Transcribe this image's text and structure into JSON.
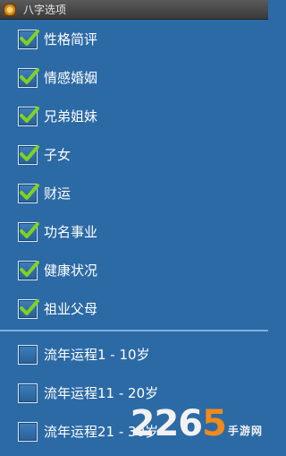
{
  "window": {
    "title": "八字选项"
  },
  "options": [
    {
      "label": "性格简评",
      "checked": true
    },
    {
      "label": "情感婚姻",
      "checked": true
    },
    {
      "label": "兄弟姐妹",
      "checked": true
    },
    {
      "label": "子女",
      "checked": true
    },
    {
      "label": "财运",
      "checked": true
    },
    {
      "label": "功名事业",
      "checked": true
    },
    {
      "label": "健康状况",
      "checked": true
    },
    {
      "label": "祖业父母",
      "checked": true
    }
  ],
  "fortune_options": [
    {
      "label": "流年运程1 - 10岁",
      "checked": false
    },
    {
      "label": "流年运程11 - 20岁",
      "checked": false
    },
    {
      "label": "流年运程21 - 30岁",
      "checked": false
    }
  ],
  "watermark": {
    "number_prefix": "226",
    "number_highlight": "5",
    "text": "手游网"
  },
  "colors": {
    "background": "#2c6aa6",
    "check": "#7ed321",
    "watermark_accent": "#f08a1c"
  }
}
